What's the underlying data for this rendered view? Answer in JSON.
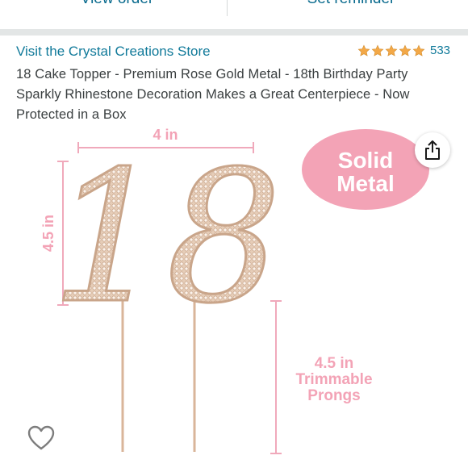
{
  "top_actions": {
    "view_order": "View order",
    "set_reminder": "Set reminder"
  },
  "store": {
    "link_text": "Visit the Crystal Creations Store",
    "rating_count": "533",
    "stars": 5
  },
  "product": {
    "title": "18 Cake Topper - Premium Rose Gold Metal - 18th Birthday Party Sparkly Rhinestone Decoration Makes a Great Centerpiece - Now Protected in a Box"
  },
  "image": {
    "width_label": "4 in",
    "height_label": "4.5 in",
    "digits": "18",
    "badge_line1": "Solid",
    "badge_line2": "Metal",
    "prong_line1": "4.5 in",
    "prong_line2": "Trimmable",
    "prong_line3": "Prongs"
  },
  "colors": {
    "link": "#117a9a",
    "star": "#f3a847",
    "pink": "#f0a9bb",
    "badge": "#f3a3b6",
    "rose_gold": "#d9b59a"
  },
  "icons": {
    "share": "share-icon",
    "wishlist": "heart-icon",
    "star": "star-icon"
  }
}
